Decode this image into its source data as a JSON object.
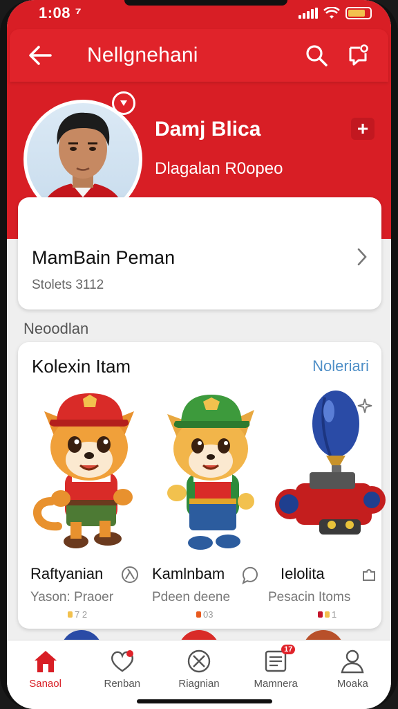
{
  "status_bar": {
    "time": "1:08 ⁷"
  },
  "app_bar": {
    "title": "Nellgnehani"
  },
  "profile": {
    "name": "Damj Blica",
    "subtitle": "Dlagalan R0opeo",
    "add_label": "+"
  },
  "main_card": {
    "title": "MamBain Peman",
    "subtitle": "Stolets 3112"
  },
  "section": {
    "label": "Neoodlan"
  },
  "collection": {
    "title": "Kolexin Itam",
    "link": "Noleriari",
    "items": [
      {
        "name": "Raftyanian",
        "sub": "Yason: Praoer",
        "dots": "7 2"
      },
      {
        "name": "Kamlnbam",
        "sub": "Pdeen deene",
        "dots": "03"
      },
      {
        "name": "Ielolita",
        "sub": "Pesacin Itoms",
        "dots": "1"
      }
    ]
  },
  "bottom_nav": {
    "items": [
      {
        "label": "Sanaol",
        "icon": "home-icon",
        "active": true
      },
      {
        "label": "Renban",
        "icon": "heart-icon"
      },
      {
        "label": "Riagnian",
        "icon": "cancel-circle-icon"
      },
      {
        "label": "Mamnera",
        "icon": "list-card-icon",
        "badge": "17"
      },
      {
        "label": "Moaka",
        "icon": "user-icon"
      }
    ]
  },
  "colors": {
    "brand_red": "#d81e25",
    "link_blue": "#4f8fc7"
  }
}
